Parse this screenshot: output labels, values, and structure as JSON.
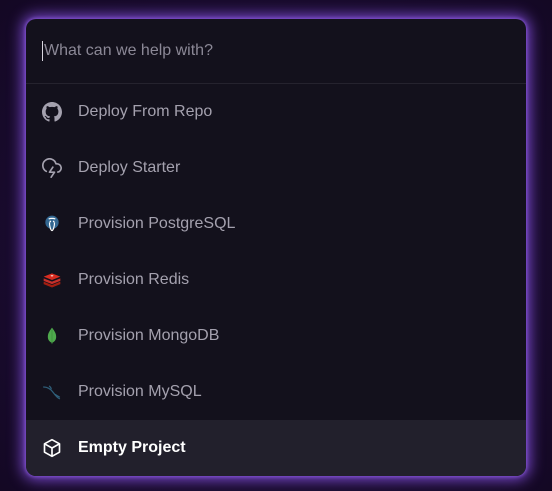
{
  "search": {
    "placeholder": "What can we help with?"
  },
  "items": [
    {
      "label": "Deploy From Repo",
      "icon": "github-icon"
    },
    {
      "label": "Deploy Starter",
      "icon": "cloud-lightning-icon"
    },
    {
      "label": "Provision PostgreSQL",
      "icon": "postgresql-icon"
    },
    {
      "label": "Provision Redis",
      "icon": "redis-icon"
    },
    {
      "label": "Provision MongoDB",
      "icon": "mongodb-icon"
    },
    {
      "label": "Provision MySQL",
      "icon": "mysql-icon"
    },
    {
      "label": "Empty Project",
      "icon": "cube-icon",
      "selected": true
    }
  ],
  "colors": {
    "accent_glow": "#8a52e6",
    "panel_bg": "#13111c",
    "selected_bg": "#22202c",
    "text_muted": "#a4a1ae",
    "text_selected": "#ffffff"
  }
}
